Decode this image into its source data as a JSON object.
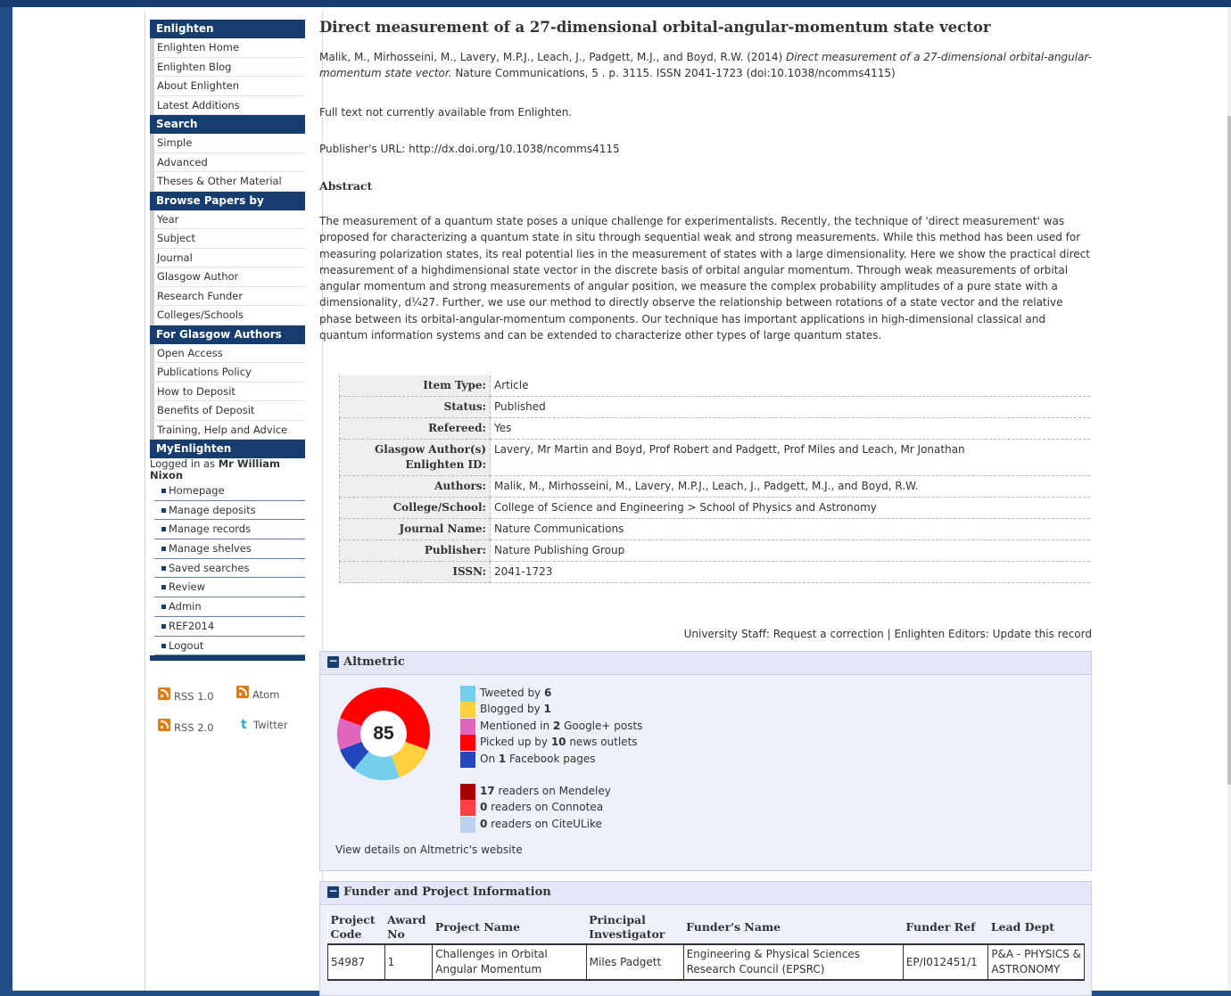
{
  "sidebar": {
    "sections": [
      {
        "heading": "Enlighten",
        "items": [
          "Enlighten Home",
          "Enlighten Blog",
          "About Enlighten",
          "Latest Additions"
        ]
      },
      {
        "heading": "Search",
        "items": [
          "Simple",
          "Advanced",
          "Theses & Other Material"
        ]
      },
      {
        "heading": "Browse Papers by",
        "items": [
          "Year",
          "Subject",
          "Journal",
          "Glasgow Author",
          "Research Funder",
          "Colleges/Schools"
        ]
      },
      {
        "heading": "For Glasgow Authors",
        "items": [
          "Open Access",
          "Publications Policy",
          "How to Deposit",
          "Benefits of Deposit",
          "Training, Help and Advice"
        ]
      },
      {
        "heading": "MyEnlighten",
        "items": []
      }
    ],
    "login": {
      "prefix": "Logged in as ",
      "user": "Mr William Nixon"
    },
    "user_menu": [
      "Homepage",
      "Manage deposits",
      "Manage records",
      "Manage shelves",
      "Saved searches",
      "Review",
      "Admin",
      "REF2014",
      "Logout"
    ],
    "feeds": {
      "rss1": "RSS 1.0",
      "atom": "Atom",
      "rss2": "RSS 2.0",
      "twitter": "Twitter"
    }
  },
  "record": {
    "title": "Direct measurement of a 27-dimensional orbital-angular-momentum state vector",
    "citation_authors": "Malik, M., Mirhosseini, M., Lavery, M.P.J., Leach, J., Padgett, M.J., and Boyd, R.W. (2014) ",
    "citation_title": "Direct measurement of a 27-dimensional orbital-angular-momentum state vector.",
    "citation_rest": " Nature Communications, 5 . p. 3115. ISSN 2041-1723 (doi:10.1038/ncomms4115)",
    "fulltext_note": "Full text not currently available from Enlighten.",
    "publisher_url": "Publisher's URL: http://dx.doi.org/10.1038/ncomms4115",
    "abstract_heading": "Abstract",
    "abstract": "The measurement of a quantum state poses a unique challenge for experimentalists. Recently, the technique of 'direct measurement' was proposed for characterizing a quantum state in situ through sequential weak and strong measurements. While this method has been used for measuring polarization states, its real potential lies in the measurement of states with a large dimensionality. Here we show the practical direct measurement of a highdimensional state vector in the discrete basis of orbital angular momentum. Through weak measurements of orbital angular momentum and strong measurements of angular position, we measure the complex probability amplitudes of a pure state with a dimensionality, d¼27. Further, we use our method to directly observe the relationship between rotations of a state vector and the relative phase between its orbital-angular-momentum components. Our technique has important applications in high-dimensional classical and quantum information systems and can be extended to characterize other types of large quantum states.",
    "fields": [
      {
        "key": "Item Type:",
        "value": "Article"
      },
      {
        "key": "Status:",
        "value": "Published"
      },
      {
        "key": "Refereed:",
        "value": "Yes"
      },
      {
        "key": "Glasgow Author(s) Enlighten ID:",
        "value": "Lavery, Mr Martin and Boyd, Prof Robert and Padgett, Prof Miles and Leach, Mr Jonathan"
      },
      {
        "key": "Authors:",
        "value": "Malik, M., Mirhosseini, M., Lavery, M.P.J., Leach, J., Padgett, M.J., and Boyd, R.W."
      },
      {
        "key": "College/School:",
        "value": "College of Science and Engineering > School of Physics and Astronomy"
      },
      {
        "key": "Journal Name:",
        "value": "Nature Communications"
      },
      {
        "key": "Publisher:",
        "value": "Nature Publishing Group"
      },
      {
        "key": "ISSN:",
        "value": "2041-1723"
      }
    ],
    "staff_prefix": "University Staff: ",
    "request_correction": "Request a correction",
    "separator": " | ",
    "editors_prefix": "Enlighten Editors: ",
    "update_record": "Update this record"
  },
  "altmetric": {
    "heading": "Altmetric",
    "score": "85",
    "sources": [
      {
        "pre": "Tweeted by ",
        "count": "6",
        "post": "",
        "color": "#74cfed"
      },
      {
        "pre": "Blogged by ",
        "count": "1",
        "post": "",
        "color": "#ffd140"
      },
      {
        "pre": "Mentioned in ",
        "count": "2",
        "post": " Google+ posts",
        "color": "#e065bb"
      },
      {
        "pre": "Picked up by ",
        "count": "10",
        "post": " news outlets",
        "color": "#ff0000"
      },
      {
        "pre": "On ",
        "count": "1",
        "post": " Facebook pages",
        "color": "#2445bd"
      }
    ],
    "readers": [
      {
        "pre": "",
        "count": "17",
        "post": " readers on Mendeley",
        "color": "#a60000"
      },
      {
        "pre": "",
        "count": "0",
        "post": " readers on Connotea",
        "color": "#ff4040"
      },
      {
        "pre": "",
        "count": "0",
        "post": " readers on CiteULike",
        "color": "#bcd1ec"
      }
    ],
    "details_link": "View details on Altmetric's website"
  },
  "funder": {
    "heading": "Funder and Project Information",
    "columns": [
      "Project Code",
      "Award No",
      "Project Name",
      "Principal Investigator",
      "Funder's Name",
      "Funder Ref",
      "Lead Dept"
    ],
    "rows": [
      [
        "54987",
        "1",
        "Challenges in Orbital Angular Momentum",
        "Miles Padgett",
        "Engineering & Physical Sciences Research Council (EPSRC)",
        "EP/I012451/1",
        "P&A - PHYSICS & ASTRONOMY"
      ]
    ]
  }
}
